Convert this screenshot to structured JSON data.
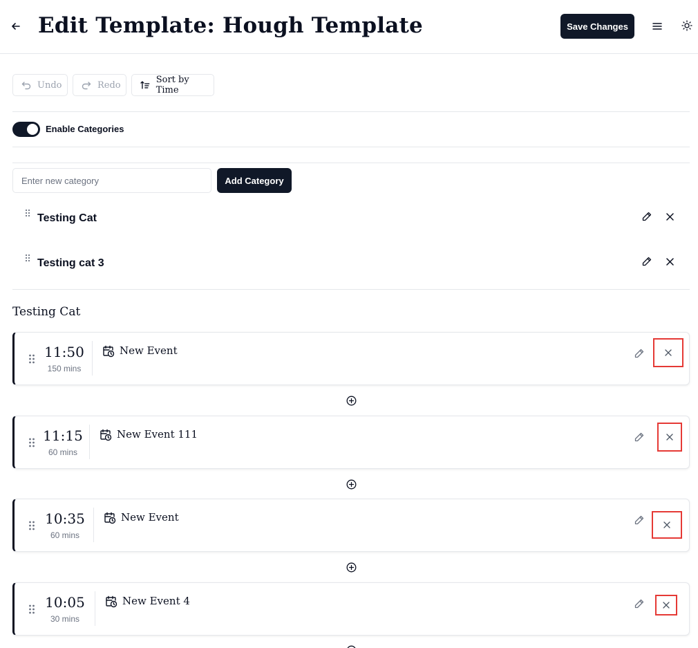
{
  "header": {
    "title": "Edit Template: Hough Template",
    "save_label": "Save Changes"
  },
  "toolbar": {
    "undo_label": "Undo",
    "redo_label": "Redo",
    "sort_label": "Sort by Time"
  },
  "categories_toggle": {
    "label": "Enable Categories",
    "enabled": true
  },
  "category_form": {
    "placeholder": "Enter new category",
    "add_label": "Add Category"
  },
  "categories": [
    {
      "name": "Testing Cat"
    },
    {
      "name": "Testing cat 3"
    }
  ],
  "section": {
    "title": "Testing Cat"
  },
  "events": [
    {
      "time": "11:50",
      "duration": "150 mins",
      "title": "New Event"
    },
    {
      "time": "11:15",
      "duration": "60 mins",
      "title": "New Event 111"
    },
    {
      "time": "10:35",
      "duration": "60 mins",
      "title": "New Event"
    },
    {
      "time": "10:05",
      "duration": "30 mins",
      "title": "New Event 4"
    }
  ],
  "colors": {
    "primary": "#101828",
    "border": "#e5e7eb",
    "muted": "#6b7280",
    "highlight": "#e53935"
  },
  "icons": {
    "back": "arrow-left-icon",
    "menu": "hamburger-icon",
    "theme": "sun-icon",
    "undo": "undo-icon",
    "redo": "redo-icon",
    "sort": "sort-icon",
    "drag": "grip-icon",
    "edit": "pencil-icon",
    "delete": "close-icon",
    "event": "calendar-clock-icon",
    "add": "plus-circle-icon"
  }
}
